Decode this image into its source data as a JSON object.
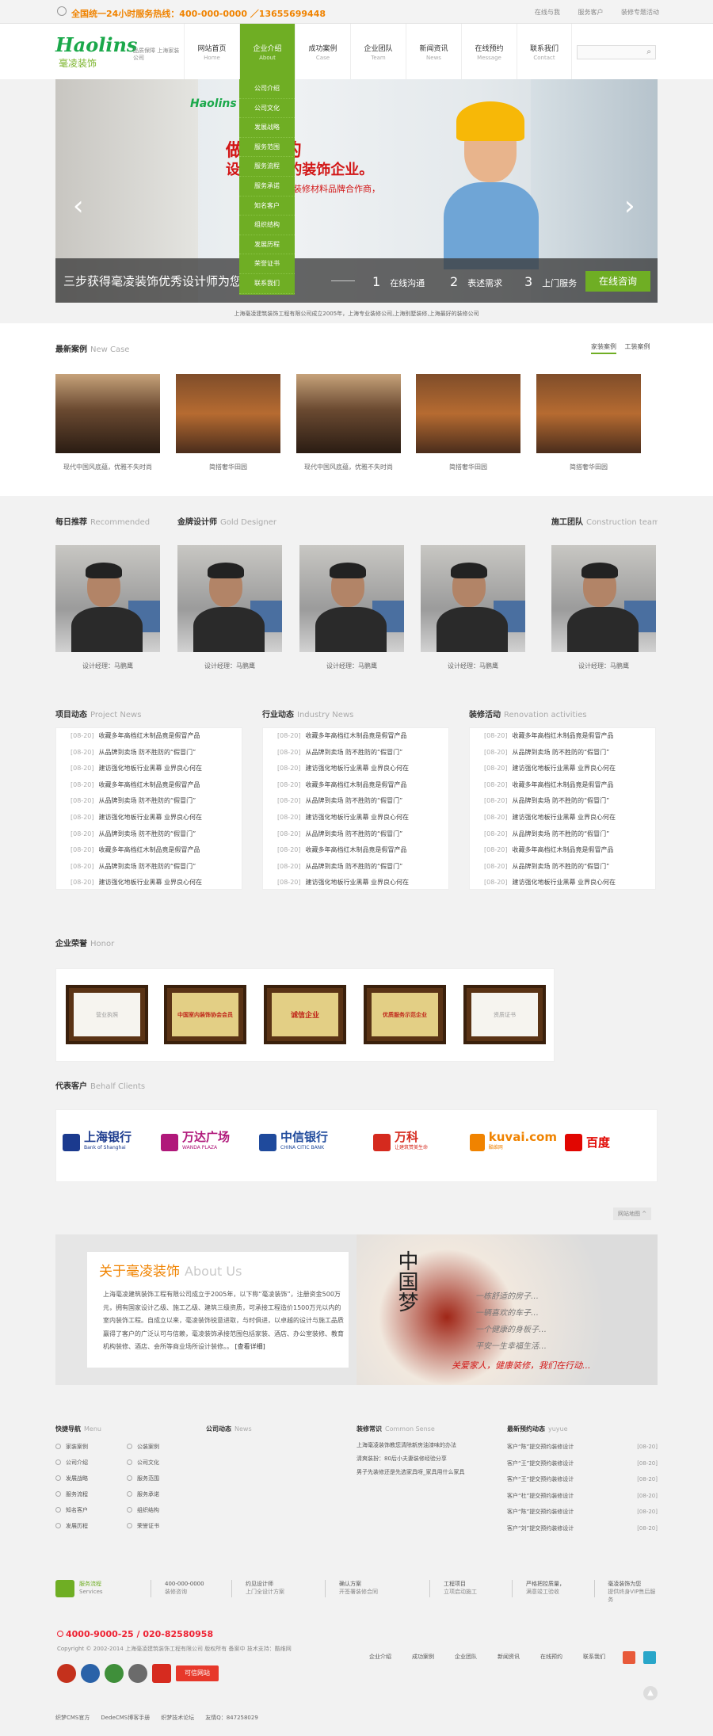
{
  "topbar": {
    "hotline": "全国统一24小时服务热线：400-000-0000 ／13655699448",
    "links": [
      "在线与我",
      "服务客户",
      "装修专题活动"
    ]
  },
  "header": {
    "logo_en": "Haolins",
    "logo_cn": "毫凌装饰",
    "slogan": "品质保障 上海家装公司"
  },
  "nav": [
    {
      "c": "网站首页",
      "e": "Home"
    },
    {
      "c": "企业介绍",
      "e": "About"
    },
    {
      "c": "成功案例",
      "e": "Case"
    },
    {
      "c": "企业团队",
      "e": "Team"
    },
    {
      "c": "新闻资讯",
      "e": "News"
    },
    {
      "c": "在线预约",
      "e": "Message"
    },
    {
      "c": "联系我们",
      "e": "Contact"
    }
  ],
  "dropdown": [
    "公司介绍",
    "公司文化",
    "发展战略",
    "服务范围",
    "服务流程",
    "服务承诺",
    "知名客户",
    "组织结构",
    "发展历程",
    "荣誉证书",
    "联系我们"
  ],
  "banner": {
    "logo": "Haolins 毫凌装饰",
    "h1": "做 专业的",
    "h2": "设 的一体的装饰企业。",
    "h3": "装修材料品牌合作商，",
    "caption": "三步获得毫凌装饰优秀设计师为您",
    "steps": [
      {
        "n": "1",
        "t": "在线沟通"
      },
      {
        "n": "2",
        "t": "表述需求"
      },
      {
        "n": "3",
        "t": "上门服务"
      }
    ],
    "consult": "在线咨询",
    "prev_icon": "‹",
    "next_icon": "›"
  },
  "intro": "上海毫凌建筑装饰工程有限公司成立2005年，上海专业装修公司,上海别墅装修,上海最好的装修公司",
  "cases": {
    "title": "最新案例",
    "title_en": "New Case",
    "tabs": [
      "家装案例",
      "工装案例"
    ],
    "items": [
      "现代中国风底蕴，优雅不失时尚",
      "简搭奢华田园",
      "现代中国风底蕴，优雅不失时尚",
      "简搭奢华田园",
      "简搭奢华田园"
    ]
  },
  "designers": {
    "groups": [
      {
        "t": "每日推荐",
        "e": "Recommended"
      },
      {
        "t": "金牌设计师",
        "e": "Gold Designer"
      },
      {
        "t": "施工团队",
        "e": "Construction team"
      }
    ],
    "items": [
      "设计经理：马鹏鹰",
      "设计经理：马鹏鹰",
      "设计经理：马鹏鹰",
      "设计经理：马鹏鹰",
      "设计经理：马鹏鹰"
    ]
  },
  "news": {
    "columns": [
      {
        "t": "项目动态",
        "e": "Project News"
      },
      {
        "t": "行业动态",
        "e": "Industry News"
      },
      {
        "t": "装修活动",
        "e": "Renovation activities"
      }
    ],
    "date": "[08-20]",
    "rows": [
      "收藏多年高档红木制品竟是假冒产品",
      "从品牌到卖场 防不胜防的“假冒门”",
      "建访强化地板行业黑幕 业界良心何在",
      "收藏多年高档红木制品竟是假冒产品",
      "从品牌到卖场 防不胜防的“假冒门”",
      "建访强化地板行业黑幕 业界良心何在",
      "从品牌到卖场 防不胜防的“假冒门”",
      "收藏多年高档红木制品竟是假冒产品",
      "从品牌到卖场 防不胜防的“假冒门”",
      "建访强化地板行业黑幕 业界良心何在"
    ]
  },
  "honor": {
    "title": "企业荣誉",
    "title_en": "Honor",
    "certs": [
      "营业执照",
      "中国室内装饰协会会员",
      "诚信企业",
      "优质服务示范企业",
      "资质证书"
    ]
  },
  "clients": {
    "title": "代表客户",
    "title_en": "Behalf Clients",
    "items": [
      {
        "name": "上海银行",
        "sub": "Bank of Shanghai",
        "color": "#1b3a8e"
      },
      {
        "name": "万达广场",
        "sub": "WANDA PLAZA",
        "color": "#b0187a"
      },
      {
        "name": "中信银行",
        "sub": "CHINA CITIC BANK",
        "color": "#1f4a9c"
      },
      {
        "name": "万科",
        "sub": "让建筑赞美生命",
        "color": "#d52a1e"
      },
      {
        "name": "kuvai.com",
        "sub": "酷维网",
        "color": "#f08300"
      },
      {
        "name": "百度",
        "sub": "",
        "color": "#e10601"
      }
    ],
    "more": "网站地图 ^"
  },
  "about": {
    "title": "关于毫凌装饰",
    "title_en": "About Us",
    "text": "上海毫凌建筑装饰工程有限公司成立于2005年，以下称“毫凌装饰”，注册资金500万元，拥有国家设计乙级、施工乙级、建筑三级资质，可承接工程造价1500万元以内的室内装饰工程。自成立以来，毫凌装饰锐意进取，与时俱进，以卓越的设计与施工品质赢得了客户的广泛认可与信赖，毫凌装饰承接范围包括家装、酒店、办公室装修、教育机构装修、酒店、会所等商业场所设计装修。。",
    "more": "[查看详细]",
    "china": "中国梦",
    "slogan": [
      "一栋舒适的房子…",
      "一辆喜欢的车子…",
      "一个健康的身板子…",
      "平安一生幸福生活…"
    ],
    "slogan2": "关爱家人，健康装修，我们在行动..."
  },
  "footer": {
    "menu_title": "快捷导航",
    "menu_title_en": "Menu",
    "menu": [
      "家装案例",
      "公装案例",
      "公司介绍",
      "公司文化",
      "发展战略",
      "服务范围",
      "服务流程",
      "服务承诺",
      "知名客户",
      "组织结构",
      "发展历程",
      "荣誉证书"
    ],
    "news_title": "公司动态",
    "news_title_en": "News",
    "sense_title": "装修常识",
    "sense_title_en": "Common Sense",
    "sense": [
      "上海毫凌装饰教您清除新房油漆味的办法",
      "清爽装扮：80后小夫妻装修经验分享",
      "男子先装修还是先选家具呀_家具用什么家具"
    ],
    "booking_title": "最新预约动态",
    "booking_title_en": "yuyue",
    "booking": [
      {
        "n": "客户“陈”提交预约装修设计",
        "d": "[08-20]"
      },
      {
        "n": "客户“王”提交预约装修设计",
        "d": "[08-20]"
      },
      {
        "n": "客户“王”提交预约装修设计",
        "d": "[08-20]"
      },
      {
        "n": "客户“杜”提交预约装修设计",
        "d": "[08-20]"
      },
      {
        "n": "客户“陈”提交预约装修设计",
        "d": "[08-20]"
      },
      {
        "n": "客户“刘”提交预约装修设计",
        "d": "[08-20]"
      }
    ],
    "services": [
      {
        "a": "服务流程",
        "b": "Services"
      },
      {
        "a": "400-000-0000",
        "b": "装修咨询"
      },
      {
        "a": "约见设计师",
        "b": "上门全设计方案"
      },
      {
        "a": "确认方案",
        "b": "开签署装修合同"
      },
      {
        "a": "工程项目",
        "b": "立项启动施工"
      },
      {
        "a": "严格把控质量，",
        "b": "满意竣工验收"
      },
      {
        "a": "毫凌装饰为您",
        "b": "提供终身VIP售后服务"
      }
    ],
    "phone": "4000-9000-25 / 020-82580958",
    "copyright": "Copyright © 2002-2014 上海毫凌建筑装饰工程有限公司 版权所有 备案中 技术支持：酷维网",
    "biglinks": [
      "企业介绍",
      "成功案例",
      "企业团队",
      "新闻资讯",
      "在线预约",
      "联系我们"
    ],
    "badge_colors": [
      "#c4311c",
      "#2a62a8",
      "#3f8f3a",
      "#6b6b6b",
      "#d62b1f"
    ],
    "badge_label": "可信网站",
    "friend_links": [
      "织梦CMS官方",
      "DedeCMS博客手册",
      "织梦技术论坛",
      "友情Q：847258029"
    ]
  },
  "colors": {
    "accent": "#6fae24",
    "orange": "#f08300",
    "red": "#d21616"
  }
}
